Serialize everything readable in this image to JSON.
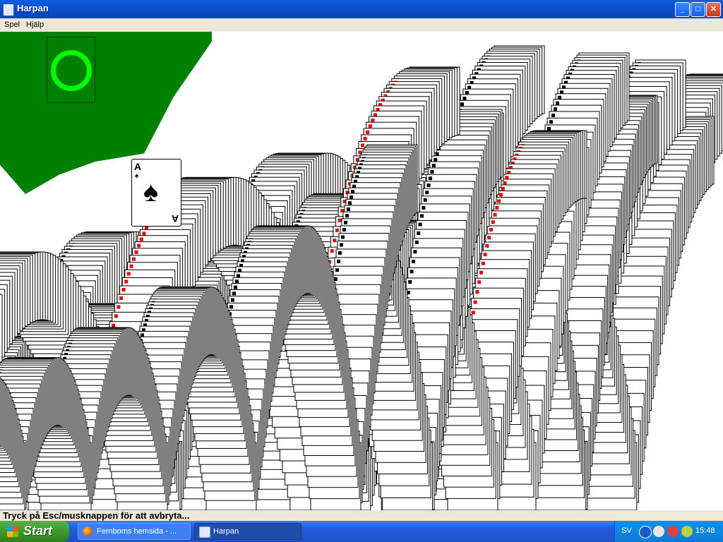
{
  "window": {
    "title": "Harpan"
  },
  "menu": {
    "items": [
      "Spel",
      "Hjälp"
    ]
  },
  "game": {
    "highlighted_card": {
      "rank": "A",
      "suit": "♠"
    }
  },
  "status": {
    "text": "Tryck på Esc/musknappen för att avbryta..."
  },
  "taskbar": {
    "start_label": "Start",
    "tasks": [
      "Fernboms hemsida - ...",
      "Harpan"
    ],
    "language": "SV",
    "clock": "15:48"
  },
  "colors": {
    "felt": "#008000",
    "slot_ring": "#00ff00",
    "red_suit": "#ff0000",
    "title_bar": "#0a4fd0"
  }
}
